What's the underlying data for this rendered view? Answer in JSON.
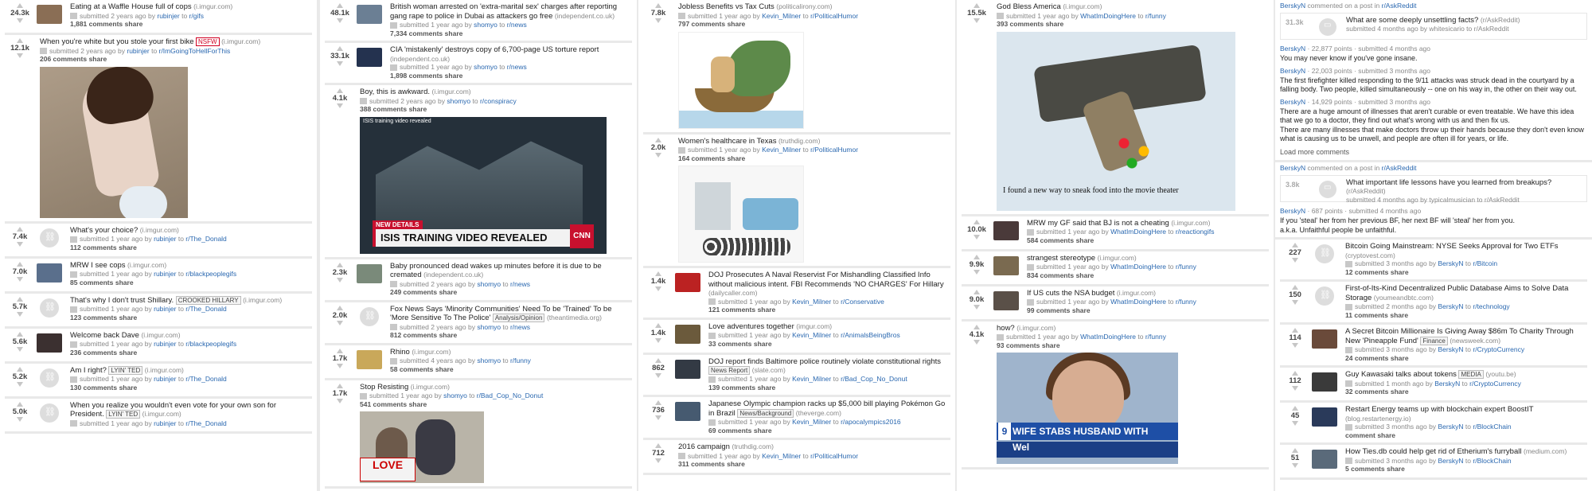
{
  "columns": [
    {
      "posts": [
        {
          "score": "24.3k",
          "title": "Eating at a Waffle House full of cops",
          "domain": "(i.imgur.com)",
          "time": "submitted 2 years ago by",
          "user": "rubinjer",
          "sub": "r/gifs",
          "comments": "1,881 comments",
          "share": "share",
          "thumb": "#8a6e55"
        },
        {
          "score": "12.1k",
          "title": "When you're white but you stole your first bike",
          "domain": "(i.imgur.com)",
          "time": "submitted 2 years ago by",
          "user": "rubinjer",
          "sub": "r/ImGoingToHellForThis",
          "nsfw": "NSFW",
          "comments": "206 comments",
          "share": "share",
          "image": "hand"
        },
        {
          "score": "7.4k",
          "title": "What's your choice?",
          "domain": "(i.imgur.com)",
          "time": "submitted 1 year ago by",
          "user": "rubinjer",
          "sub": "r/The_Donald",
          "comments": "112 comments",
          "share": "share",
          "link": true
        },
        {
          "score": "7.0k",
          "title": "MRW I see cops",
          "domain": "(i.imgur.com)",
          "time": "submitted 1 year ago by",
          "user": "rubinjer",
          "sub": "r/blackpeoplegifs",
          "comments": "85 comments",
          "share": "share",
          "thumb": "#5a6f8c"
        },
        {
          "score": "5.7k",
          "title": "That's why I don't trust Shillary.",
          "flair": "CROOKED HILLARY",
          "domain": "(i.imgur.com)",
          "time": "submitted 1 year ago by",
          "user": "rubinjer",
          "sub": "r/The_Donald",
          "comments": "123 comments",
          "share": "share",
          "link": true
        },
        {
          "score": "5.6k",
          "title": "Welcome back Dave",
          "domain": "(i.imgur.com)",
          "time": "submitted 1 year ago by",
          "user": "rubinjer",
          "sub": "r/blackpeoplegifs",
          "comments": "236 comments",
          "share": "share",
          "thumb": "#3b3030"
        },
        {
          "score": "5.2k",
          "title": "Am I right?",
          "flair": "LYIN' TED",
          "domain": "(i.imgur.com)",
          "time": "submitted 1 year ago by",
          "user": "rubinjer",
          "sub": "r/The_Donald",
          "comments": "130 comments",
          "share": "share",
          "link": true
        },
        {
          "score": "5.0k",
          "title": "When you realize you wouldn't even vote for your own son for President.",
          "flair": "LYIN' TED",
          "domain": "(i.imgur.com)",
          "time": "submitted 1 year ago by",
          "user": "rubinjer",
          "sub": "r/The_Donald",
          "comments": "",
          "share": "",
          "link": true
        }
      ]
    },
    {
      "posts": [
        {
          "score": "48.1k",
          "title": "British woman arrested on 'extra-marital sex' charges after reporting gang rape to police in Dubai as attackers go free",
          "domain": "(independent.co.uk)",
          "time": "submitted 1 year ago by",
          "user": "shomyo",
          "sub": "r/news",
          "comments": "7,334 comments",
          "share": "share",
          "thumb": "#6b7f94"
        },
        {
          "score": "33.1k",
          "title": "CIA 'mistakenly' destroys copy of 6,700-page US torture report",
          "domain": "(independent.co.uk)",
          "time": "submitted 1 year ago by",
          "user": "shomyo",
          "sub": "r/news",
          "comments": "1,898 comments",
          "share": "share",
          "thumb": "#24324f"
        },
        {
          "score": "4.1k",
          "title": "Boy, this is awkward.",
          "domain": "(i.imgur.com)",
          "time": "submitted 2 years ago by",
          "user": "shomyo",
          "sub": "r/conspiracy",
          "comments": "388 comments",
          "share": "share",
          "image": "isis",
          "img_top": "ISIS training video revealed",
          "img_new": "NEW DETAILS",
          "img_bar": "ISIS TRAINING VIDEO REVEALED",
          "img_cnn": "CNN"
        },
        {
          "score": "2.3k",
          "title": "Baby pronounced dead wakes up minutes before it is due to be cremated",
          "domain": "(independent.co.uk)",
          "time": "submitted 2 years ago by",
          "user": "shomyo",
          "sub": "r/news",
          "comments": "249 comments",
          "share": "share",
          "thumb": "#7a8a7a"
        },
        {
          "score": "2.0k",
          "title": "Fox News Says 'Minority Communities' Need To be 'Trained' To be 'More Sensitive To The Police'",
          "flair": "Analysis/Opinion",
          "domain": "(theantimedia.org)",
          "time": "submitted 2 years ago by",
          "user": "shomyo",
          "sub": "r/news",
          "comments": "812 comments",
          "share": "share",
          "link": true
        },
        {
          "score": "1.7k",
          "title": "Rhino",
          "domain": "(i.imgur.com)",
          "time": "submitted 4 years ago by",
          "user": "shomyo",
          "sub": "r/funny",
          "comments": "58 comments",
          "share": "share",
          "thumb": "#c9a85a"
        },
        {
          "score": "1.7k",
          "title": "Stop Resisting",
          "domain": "(i.imgur.com)",
          "time": "submitted 1 year ago by",
          "user": "shomyo",
          "sub": "r/Bad_Cop_No_Donut",
          "comments": "541 comments",
          "share": "share",
          "image": "protest",
          "img_sign": "LOVE"
        }
      ]
    },
    {
      "posts": [
        {
          "score": "7.8k",
          "title": "Jobless Benefits vs Tax Cuts",
          "domain": "(politicalirony.com)",
          "time": "submitted 1 year ago by",
          "user": "Kevin_Milner",
          "sub": "r/PoliticalHumor",
          "comments": "797 comments",
          "share": "share",
          "image": "cartoon"
        },
        {
          "score": "2.0k",
          "title": "Women's healthcare in Texas",
          "domain": "(truthdig.com)",
          "time": "submitted 1 year ago by",
          "user": "Kevin_Milner",
          "sub": "r/PoliticalHumor",
          "comments": "164 comments",
          "share": "share",
          "image": "cartoon2"
        },
        {
          "score": "1.4k",
          "title": "DOJ Prosecutes A Naval Reservist For Mishandling Classified Info without malicious intent. FBI Recommends 'NO CHARGES' For Hillary",
          "domain": "(dailycaller.com)",
          "time": "submitted 1 year ago by",
          "user": "Kevin_Milner",
          "sub": "r/Conservative",
          "comments": "121 comments",
          "share": "share",
          "thumb": "#b22"
        },
        {
          "score": "1.4k",
          "title": "Love adventures together",
          "domain": "(imgur.com)",
          "time": "submitted 1 year ago by",
          "user": "Kevin_Milner",
          "sub": "r/AnimalsBeingBros",
          "comments": "33 comments",
          "share": "share",
          "thumb": "#6b5a3c"
        },
        {
          "score": "862",
          "title": "DOJ report finds Baltimore police routinely violate constitutional rights",
          "flair": "News Report",
          "domain": "(slate.com)",
          "time": "submitted 1 year ago by",
          "user": "Kevin_Milner",
          "sub": "r/Bad_Cop_No_Donut",
          "comments": "139 comments",
          "share": "share",
          "thumb": "#333a44"
        },
        {
          "score": "736",
          "title": "Japanese Olympic champion racks up $5,000 bill playing Pokémon Go in Brazil",
          "flair": "News/Background",
          "domain": "(theverge.com)",
          "time": "submitted 1 year ago by",
          "user": "Kevin_Milner",
          "sub": "r/apocalympics2016",
          "comments": "69 comments",
          "share": "share",
          "thumb": "#465a70"
        },
        {
          "score": "712",
          "title": "2016 campaign",
          "domain": "(truthdig.com)",
          "time": "submitted 1 year ago by",
          "user": "Kevin_Milner",
          "sub": "r/PoliticalHumor",
          "comments": "311 comments",
          "share": "share"
        }
      ]
    },
    {
      "posts": [
        {
          "score": "15.5k",
          "title": "God Bless America",
          "domain": "(i.imgur.com)",
          "time": "submitted 1 year ago by",
          "user": "WhatImDoingHere",
          "sub": "r/funny",
          "comments": "393 comments",
          "share": "share",
          "image": "gun",
          "img_caption": "I found a new way to sneak food into the movie theater"
        },
        {
          "score": "10.0k",
          "title": "MRW my GF said that BJ is not a cheating",
          "domain": "(i.imgur.com)",
          "time": "submitted 1 year ago by",
          "user": "WhatImDoingHere",
          "sub": "r/reactiongifs",
          "comments": "584 comments",
          "share": "share",
          "thumb": "#4a3a3a"
        },
        {
          "score": "9.9k",
          "title": "strangest stereotype",
          "domain": "(i.imgur.com)",
          "time": "submitted 1 year ago by",
          "user": "WhatImDoingHere",
          "sub": "r/funny",
          "comments": "834 comments",
          "share": "share",
          "thumb": "#7a6a50"
        },
        {
          "score": "9.0k",
          "title": "If US cuts the NSA budget",
          "domain": "(i.imgur.com)",
          "time": "submitted 1 year ago by",
          "user": "WhatImDoingHere",
          "sub": "r/funny",
          "comments": "99 comments",
          "share": "share",
          "thumb": "#5a5048"
        },
        {
          "score": "4.1k",
          "title": "how?",
          "domain": "(i.imgur.com)",
          "time": "submitted 1 year ago by",
          "user": "WhatImDoingHere",
          "sub": "r/funny",
          "comments": "93 comments",
          "share": "share",
          "image": "news",
          "img_ch": "9",
          "img_lower": "WIFE STABS HUSBAND WITH SQUIRREL",
          "img_wel": "Wel"
        }
      ]
    }
  ],
  "activity": [
    {
      "kind": "comments",
      "header_user": "BerskyN",
      "header_text": "commented on a post in",
      "header_sub": "r/AskReddit",
      "quote": {
        "score": "31.3k",
        "title": "What are some deeply unsettling facts?",
        "sub": "(r/AskReddit)",
        "meta": "submitted 4 months ago by whitesicario to r/AskReddit"
      },
      "comments": [
        {
          "user": "BerskyN",
          "meta": "· 22,877 points · submitted 4 months ago",
          "lines": [
            "You may never know if you've gone insane."
          ]
        },
        {
          "user": "BerskyN",
          "meta": "· 22,003 points · submitted 3 months ago",
          "lines": [
            "The first firefighter killed responding to the 9/11 attacks was struck dead in the courtyard by a falling body. Two people, killed simultaneously -- one on his way in, the other on their way out."
          ]
        },
        {
          "user": "BerskyN",
          "meta": "· 14,929 points · submitted 3 months ago",
          "lines": [
            "There are a huge amount of illnesses that aren't curable or even treatable. We have this idea that we go to a doctor, they find out what's wrong with us and then fix us.",
            "There are many illnesses that make doctors throw up their hands because they don't even know what is causing us to be unwell, and people are often ill for years, or life."
          ]
        }
      ],
      "load_more": "Load more comments"
    },
    {
      "kind": "comments",
      "header_user": "BerskyN",
      "header_text": "commented on a post in",
      "header_sub": "r/AskReddit",
      "quote": {
        "score": "3.8k",
        "title": "What important life lessons have you learned from breakups?",
        "sub": "(r/AskReddit)",
        "meta": "submitted 4 months ago by typicalmusician to r/AskReddit"
      },
      "comments": [
        {
          "user": "BerskyN",
          "meta": "· 687 points · submitted 4 months ago",
          "lines": [
            "If you 'steal' her from her previous BF, her next BF will 'steal' her from you.",
            "a.k.a. Unfaithful people be unfaithful."
          ]
        }
      ]
    }
  ],
  "col5_posts": [
    {
      "score": "227",
      "title": "Bitcoin Going Mainstream: NYSE Seeks Approval for Two ETFs",
      "domain": "(cryptovest.com)",
      "time": "submitted 3 months ago by",
      "user": "BerskyN",
      "sub": "r/Bitcoin",
      "comments": "12 comments",
      "share": "share",
      "link": true
    },
    {
      "score": "150",
      "title": "First-of-Its-Kind Decentralized Public Database Aims to Solve Data Storage",
      "domain": "(youmeandbtc.com)",
      "time": "submitted 2 months ago by",
      "user": "BerskyN",
      "sub": "r/technology",
      "comments": "11 comments",
      "share": "share",
      "link": true
    },
    {
      "score": "114",
      "title": "A Secret Bitcoin Millionaire Is Giving Away $86m To Charity Through New 'Pineapple Fund'",
      "flair": "Finance",
      "domain": "(newsweek.com)",
      "time": "submitted 3 months ago by",
      "user": "BerskyN",
      "sub": "r/CryptoCurrency",
      "comments": "24 comments",
      "share": "share",
      "thumb": "#6a4a3a"
    },
    {
      "score": "112",
      "title": "Guy Kawasaki talks about tokens",
      "flair": "MEDIA",
      "domain": "(youtu.be)",
      "time": "submitted 1 month ago by",
      "user": "BerskyN",
      "sub": "r/CryptoCurrency",
      "comments": "32 comments",
      "share": "share",
      "thumb": "#3a3a3a"
    },
    {
      "score": "45",
      "title": "Restart Energy teams up with blockchain expert BoostIT",
      "domain": "(blog.restartenergy.io)",
      "time": "submitted 3 months ago by",
      "user": "BerskyN",
      "sub": "r/BlockChain",
      "comments": "comment",
      "share": "share",
      "thumb": "#2a3a5a"
    },
    {
      "score": "51",
      "title": "How Ties.db could help get rid of Etherium's furryball",
      "domain": "(medium.com)",
      "time": "submitted 3 months ago by",
      "user": "BerskyN",
      "sub": "r/BlockChain",
      "comments": "5 comments",
      "share": "share",
      "thumb": "#5a6a7a"
    }
  ]
}
